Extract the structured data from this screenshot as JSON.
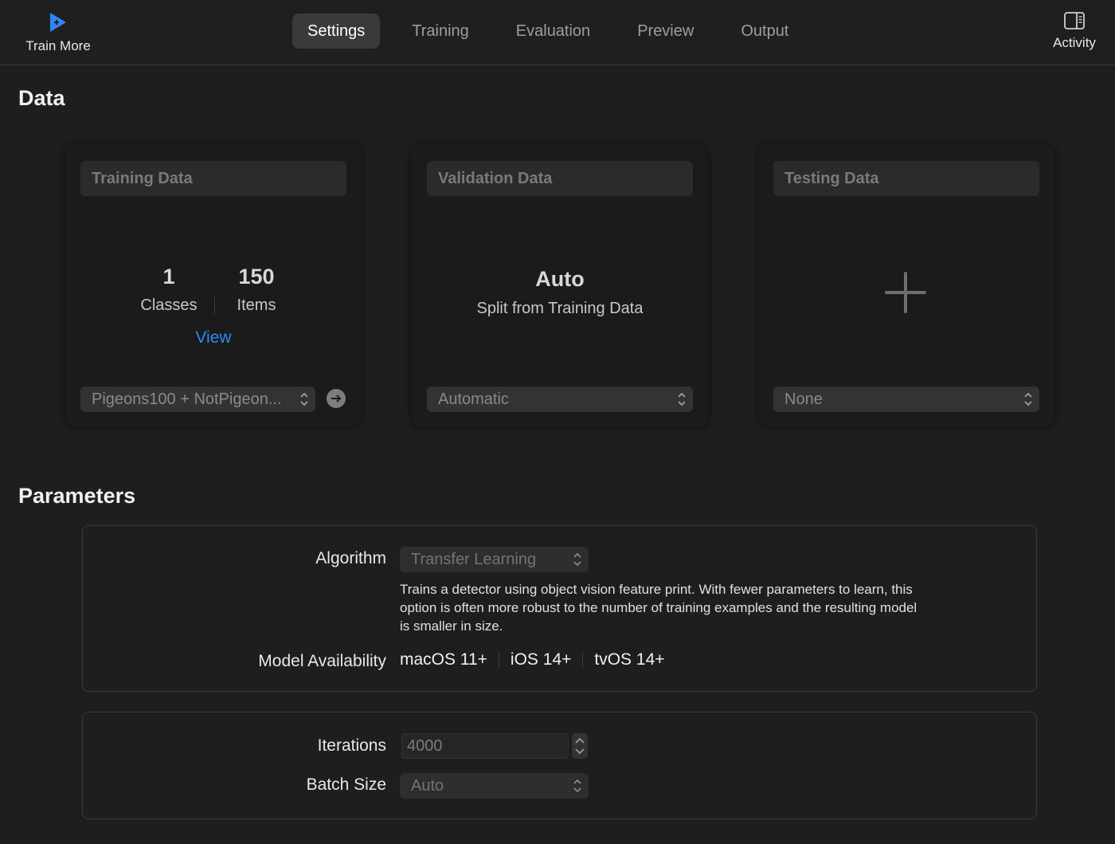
{
  "toolbar": {
    "train_more_label": "Train More",
    "activity_label": "Activity",
    "tabs": [
      {
        "label": "Settings",
        "active": true
      },
      {
        "label": "Training",
        "active": false
      },
      {
        "label": "Evaluation",
        "active": false
      },
      {
        "label": "Preview",
        "active": false
      },
      {
        "label": "Output",
        "active": false
      }
    ],
    "accent_color": "#2f86f6"
  },
  "data_section": {
    "title": "Data",
    "training": {
      "header": "Training Data",
      "classes_count": "1",
      "classes_label": "Classes",
      "items_count": "150",
      "items_label": "Items",
      "view_link": "View",
      "source": "Pigeons100 + NotPigeon..."
    },
    "validation": {
      "header": "Validation Data",
      "main": "Auto",
      "sub": "Split from Training Data",
      "selection": "Automatic"
    },
    "testing": {
      "header": "Testing Data",
      "selection": "None"
    }
  },
  "parameters": {
    "title": "Parameters",
    "algorithm_label": "Algorithm",
    "algorithm_value": "Transfer Learning",
    "algorithm_description": "Trains a detector using object vision feature print. With fewer parameters to learn, this option is often more robust to the number of training examples and the resulting model is smaller in size.",
    "availability_label": "Model Availability",
    "platforms": [
      "macOS 11+",
      "iOS 14+",
      "tvOS 14+"
    ],
    "iterations_label": "Iterations",
    "iterations_value": "4000",
    "batch_size_label": "Batch Size",
    "batch_size_value": "Auto"
  }
}
